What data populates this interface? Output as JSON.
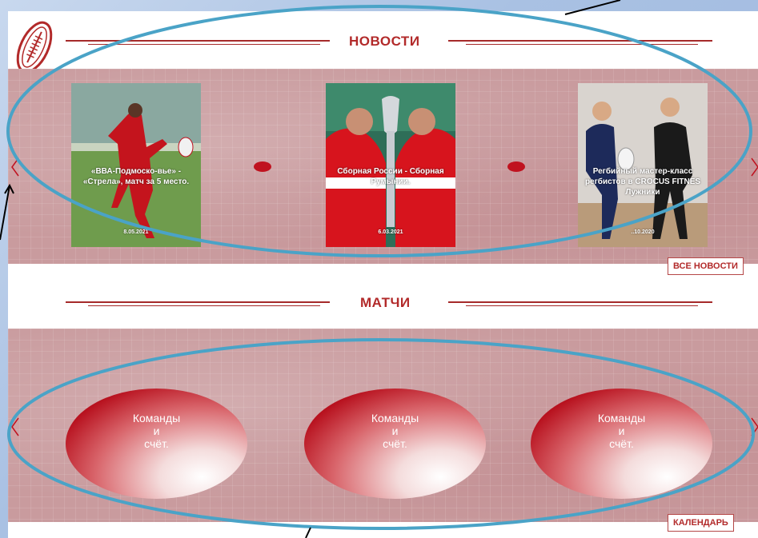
{
  "news": {
    "heading": "НОВОСТИ",
    "cards": [
      {
        "caption": "«ВВА-Подмоско-вье» - «Стрела», матч за 5 место.",
        "date": "8.05.2021"
      },
      {
        "caption": "Сборная России - Сборная Румынии.",
        "date": "6.03.2021"
      },
      {
        "caption": "Регбийный мастер-класс регбистов в CROCUS FITNES Лужники",
        "date": "..10.2020"
      }
    ],
    "all_news_label": "ВСЕ НОВОСТИ"
  },
  "matches": {
    "heading": "МАТЧИ",
    "items": [
      {
        "line1": "Команды",
        "line2": "и",
        "line3": "счёт."
      },
      {
        "line1": "Команды",
        "line2": "и",
        "line3": "счёт."
      },
      {
        "line1": "Команды",
        "line2": "и",
        "line3": "счёт."
      }
    ],
    "calendar_label": "КАЛЕНДАРЬ"
  },
  "colors": {
    "accent": "#b22a2a",
    "dot": "#c0121f",
    "band": "#c99b9e",
    "annotation": "#4aa3c7"
  },
  "icons": [
    "rugby-ball-logo-icon",
    "chevron-left-icon",
    "chevron-right-icon"
  ]
}
